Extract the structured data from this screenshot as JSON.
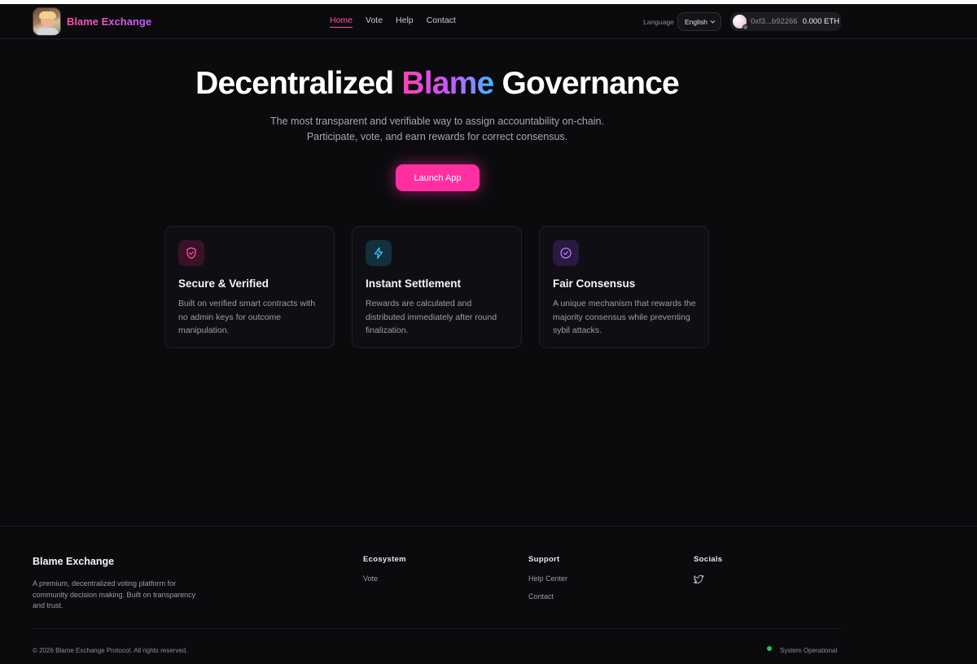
{
  "header": {
    "brand": "Blame Exchange",
    "nav": [
      {
        "label": "Home",
        "active": true
      },
      {
        "label": "Vote",
        "active": false
      },
      {
        "label": "Help",
        "active": false
      },
      {
        "label": "Contact",
        "active": false
      }
    ],
    "language_label": "Language",
    "language_selected": "English",
    "wallet_address": "0xf3...b92266",
    "wallet_balance": "0.000 ETH"
  },
  "hero": {
    "title_before": "Decentralized ",
    "title_highlight": "Blame",
    "title_after": " Governance",
    "subtitle_line1": "The most transparent and verifiable way to assign accountability on-chain.",
    "subtitle_line2": "Participate, vote, and earn rewards for correct consensus.",
    "cta": "Launch App"
  },
  "features": [
    {
      "icon": "shield-check-icon",
      "title": "Secure & Verified",
      "description": "Built on verified smart contracts with no admin keys for outcome manipulation.",
      "accent": "#ff4fa8"
    },
    {
      "icon": "lightning-icon",
      "title": "Instant Settlement",
      "description": "Rewards are calculated and distributed immediately after round finalization.",
      "accent": "#3fc1ff"
    },
    {
      "icon": "check-circle-icon",
      "title": "Fair Consensus",
      "description": "A unique mechanism that rewards the majority consensus while preventing sybil attacks.",
      "accent": "#b07bff"
    }
  ],
  "footer": {
    "brand": "Blame Exchange",
    "description": "A premium, decentralized voting platform for community decision making. Built on transparency and trust.",
    "columns": [
      {
        "title": "Ecosystem",
        "links": [
          "Vote"
        ]
      },
      {
        "title": "Support",
        "links": [
          "Help Center",
          "Contact"
        ]
      },
      {
        "title": "Socials",
        "links": []
      }
    ],
    "copyright": "© 2026 Blame Exchange Protocol. All rights reserved.",
    "status": "System Operational"
  },
  "colors": {
    "background": "#0b0b0e",
    "accent_pink": "#ff2fa2",
    "status_green": "#22c55e"
  }
}
